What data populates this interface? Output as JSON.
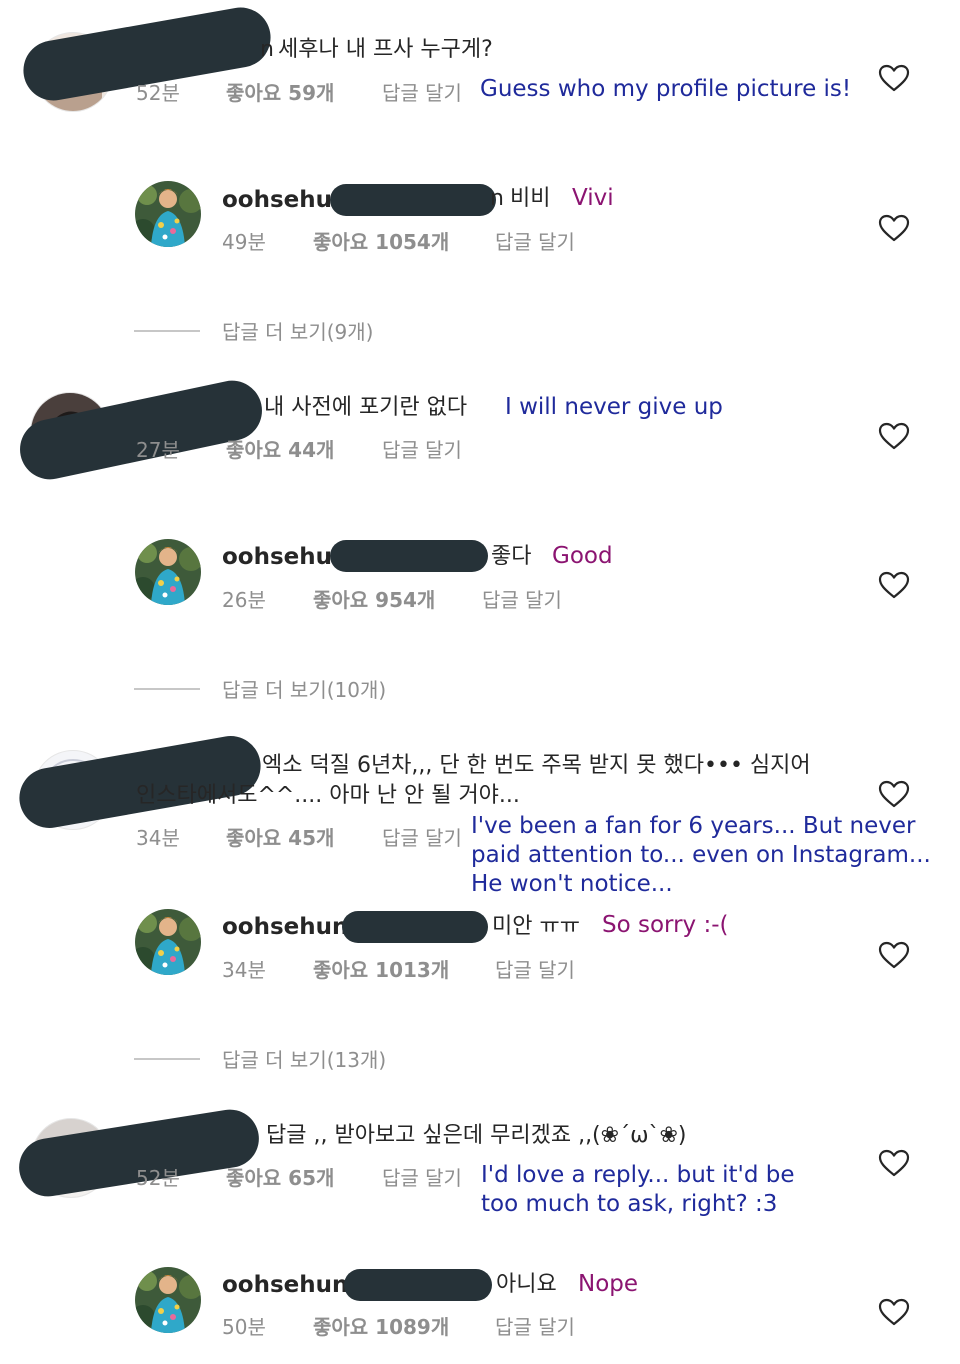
{
  "threads": [
    {
      "fan": {
        "username_tail": "n",
        "text": "세후나 내 프사 누구게?",
        "time": "52분",
        "likes": "좋아요 59개",
        "reply_label": "답글 달기",
        "translation": "Guess who my profile picture is!"
      },
      "reply": {
        "username": "oohsehun",
        "mention_tail": "n",
        "text": "비비",
        "translation": "Vivi",
        "time": "49분",
        "likes": "좋아요 1054개",
        "reply_label": "답글 달기"
      },
      "view_more": "답글 더 보기(9개)"
    },
    {
      "fan": {
        "username_tail": "",
        "text": "내 사전에 포기란 없다",
        "time": "27분",
        "likes": "좋아요 44개",
        "reply_label": "답글 달기",
        "translation": "I will never give up"
      },
      "reply": {
        "username": "oohsehun",
        "mention_tail": "",
        "text": "좋다",
        "translation": "Good",
        "time": "26분",
        "likes": "좋아요 954개",
        "reply_label": "답글 달기"
      },
      "view_more": "답글 더 보기(10개)"
    },
    {
      "fan": {
        "username_tail": "",
        "text_line1": "엑소 덕질 6년차,,, 단 한 번도 주목 받지 못 했다••• 심지어",
        "text_line2": "인스타에서도^^.... 아마 난 안 될 거야...",
        "time": "34분",
        "likes": "좋아요 45개",
        "reply_label": "답글 달기",
        "translation_line1": "I've been a fan for 6 years... But never",
        "translation_line2": "paid attention to... even on Instagram...",
        "translation_line3": "He won't notice..."
      },
      "reply": {
        "username": "oohsehun",
        "mention_tail": "",
        "text": "미안 ㅠㅠ",
        "translation": "So sorry :-(",
        "time": "34분",
        "likes": "좋아요 1013개",
        "reply_label": "답글 달기"
      },
      "view_more": "답글 더 보기(13개)"
    },
    {
      "fan": {
        "username_tail": "",
        "text": "답글 ,, 받아보고 싶은데 무리겠죠 ,,(❀´ω`❀)",
        "time": "52분",
        "likes": "좋아요 65개",
        "reply_label": "답글 달기",
        "translation_line1": "I'd love a reply... but it'd be",
        "translation_line2": "too much to ask, right? :3"
      },
      "reply": {
        "username": "oohsehun",
        "mention_tail": "",
        "text": "아니요",
        "translation": "Nope",
        "time": "50분",
        "likes": "좋아요 1089개",
        "reply_label": "답글 달기"
      }
    }
  ],
  "colors": {
    "translation_fan": "#1f2a9b",
    "translation_reply": "#8b1471",
    "redaction": "#263238",
    "meta_gray": "#8e8e8e"
  },
  "icons": {
    "like": "heart-outline-icon"
  }
}
